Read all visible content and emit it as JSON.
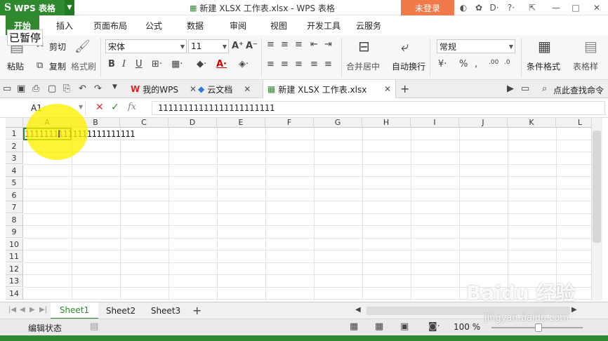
{
  "titlebar": {
    "app_name": "WPS 表格",
    "doc_title": "新建 XLSX 工作表.xlsx - WPS 表格",
    "login_button": "未登录"
  },
  "overlay": {
    "paused": "已暂停"
  },
  "ribbon_tabs": [
    "开始",
    "插入",
    "页面布局",
    "公式",
    "数据",
    "审阅",
    "视图",
    "开发工具",
    "云服务"
  ],
  "ribbon": {
    "paste": "粘贴",
    "cut": "剪切",
    "copy": "复制",
    "format_painter": "格式刷",
    "font_name": "宋体",
    "font_size": "11",
    "merge_center": "合并居中",
    "wrap_text": "自动换行",
    "number_format": "常规",
    "conditional_format": "条件格式",
    "table_style": "表格样"
  },
  "doc_tabs": {
    "my_wps": "我的WPS",
    "cloud_docs": "云文档",
    "active_doc": "新建 XLSX 工作表.xlsx",
    "search": "点此查找命令"
  },
  "formula_bar": {
    "cell_ref": "A1",
    "content": "11111111111111111111111"
  },
  "grid": {
    "columns": [
      "A",
      "B",
      "C",
      "D",
      "E",
      "F",
      "G",
      "H",
      "I",
      "J",
      "K",
      "L"
    ],
    "rows": [
      "1",
      "2",
      "3",
      "4",
      "5",
      "6",
      "7",
      "8",
      "9",
      "10",
      "11",
      "12",
      "13",
      "14"
    ],
    "a1_value": "11111111111111111111111"
  },
  "sheets": [
    "Sheet1",
    "Sheet2",
    "Sheet3"
  ],
  "status": {
    "mode": "编辑状态",
    "zoom": "100 %"
  },
  "watermark": {
    "brand": "Baidu 经验",
    "url": "jingyan.baidu.com"
  },
  "colors": {
    "accent": "#2f8a2f",
    "login": "#f07a4a",
    "highlight": "#fff000"
  }
}
